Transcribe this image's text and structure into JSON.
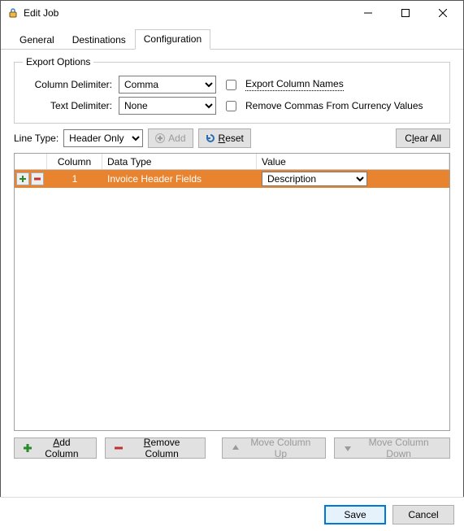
{
  "window": {
    "title": "Edit Job"
  },
  "tabs": {
    "general": "General",
    "destinations": "Destinations",
    "configuration": "Configuration"
  },
  "export": {
    "legend": "Export Options",
    "column_delim_label": "Column Delimiter:",
    "column_delim_value": "Comma",
    "text_delim_label": "Text Delimiter:",
    "text_delim_value": "None",
    "export_col_names": "Export Column Names",
    "remove_commas": "Remove Commas From Currency Values"
  },
  "linetype": {
    "label": "Line Type:",
    "value": "Header Only",
    "add": "Add",
    "reset": "Reset",
    "clear_all_pre": "C",
    "clear_all_mid": "lear All"
  },
  "grid": {
    "hdr_column": "Column",
    "hdr_datatype": "Data Type",
    "hdr_value": "Value",
    "rows": [
      {
        "col": "1",
        "type": "Invoice Header Fields",
        "value": "Description"
      }
    ]
  },
  "actions": {
    "add_column_pre": "A",
    "add_column_rest": "dd Column",
    "remove_column_pre": "R",
    "remove_column_rest": "emove Column",
    "move_up_pre": "Move Column ",
    "move_up_u": "U",
    "move_up_post": "p",
    "move_down_pre": "Move Column ",
    "move_down_u": "D",
    "move_down_post": "own"
  },
  "footer": {
    "save": "Save",
    "cancel": "Cancel"
  }
}
